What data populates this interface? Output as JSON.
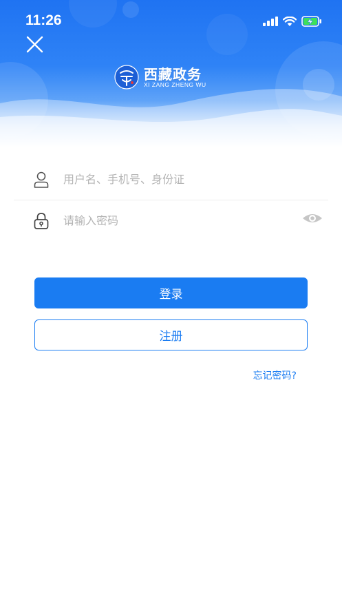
{
  "status_bar": {
    "time": "11:26",
    "battery_state": "charging"
  },
  "header": {
    "close_icon": "close-icon",
    "logo": {
      "title": "西藏政务",
      "subtitle": "XI ZANG ZHENG WU"
    }
  },
  "form": {
    "username": {
      "placeholder": "用户名、手机号、身份证",
      "value": "",
      "icon": "user-icon"
    },
    "password": {
      "placeholder": "请输入密码",
      "value": "",
      "icon": "lock-icon",
      "toggle_icon": "eye-icon"
    }
  },
  "buttons": {
    "login_label": "登录",
    "register_label": "注册"
  },
  "links": {
    "forgot_password": "忘记密码?"
  },
  "colors": {
    "primary": "#1a7cf2",
    "header_top": "#1f73f2",
    "placeholder": "#b4b4b4"
  }
}
